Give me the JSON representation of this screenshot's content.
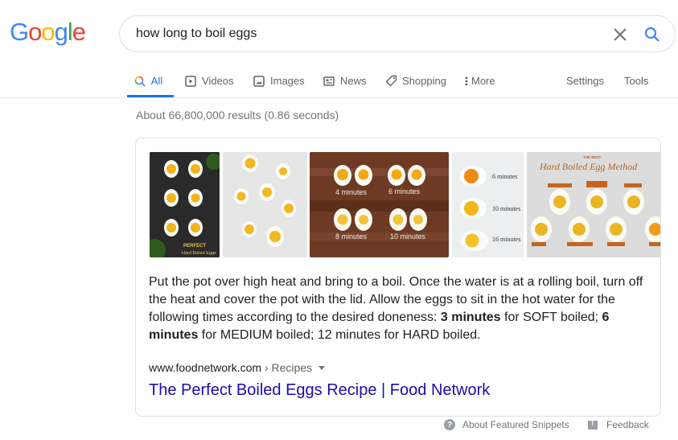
{
  "logo": {
    "letters": [
      {
        "char": "G",
        "color": "#4285f4"
      },
      {
        "char": "o",
        "color": "#ea4335"
      },
      {
        "char": "o",
        "color": "#fbbc05"
      },
      {
        "char": "g",
        "color": "#4285f4"
      },
      {
        "char": "l",
        "color": "#34a853"
      },
      {
        "char": "e",
        "color": "#ea4335"
      }
    ]
  },
  "search": {
    "query": "how long to boil eggs",
    "clear_icon": "close-icon",
    "search_icon": "search-icon"
  },
  "tabs": [
    {
      "label": "All",
      "icon": "search-icon",
      "active": true
    },
    {
      "label": "Videos",
      "icon": "play-icon",
      "active": false
    },
    {
      "label": "Images",
      "icon": "image-icon",
      "active": false
    },
    {
      "label": "News",
      "icon": "newspaper-icon",
      "active": false
    },
    {
      "label": "Shopping",
      "icon": "tag-icon",
      "active": false
    },
    {
      "label": "More",
      "icon": "more-vert-icon",
      "active": false
    },
    {
      "label": "Settings",
      "active": false
    },
    {
      "label": "Tools",
      "active": false
    }
  ],
  "result_stats": "About 66,800,000 results (0.86 seconds)",
  "featured_snippet": {
    "images": [
      {
        "alt": "Perfect Hard Boiled Eggs chart",
        "labels": [
          "PERFECT",
          "Hard Boiled Eggs"
        ]
      },
      {
        "alt": "Boiled eggs doneness levels",
        "labels": []
      },
      {
        "alt": "Eggs on wooden board",
        "labels": [
          "4 minutes",
          "6 minutes",
          "8 minutes",
          "10 minutes"
        ]
      },
      {
        "alt": "Eggs by minutes",
        "labels": [
          "6 minutes",
          "10 minutes",
          "16 minutes"
        ]
      },
      {
        "alt": "The Best Hard Boiled Egg Method",
        "labels": [
          "THE BEST",
          "Hard Boiled Egg Method"
        ]
      }
    ],
    "text_parts": [
      {
        "text": "Put the pot over high heat and bring to a boil. Once the water is at a rolling boil, turn off the heat and cover the pot with the lid. Allow the eggs to sit in the hot water for the following times according to the desired doneness: ",
        "bold": false
      },
      {
        "text": "3 minutes",
        "bold": true
      },
      {
        "text": " for SOFT boiled; ",
        "bold": false
      },
      {
        "text": "6 minutes",
        "bold": true
      },
      {
        "text": " for MEDIUM boiled; 12 minutes for HARD boiled.",
        "bold": false
      }
    ],
    "cite_domain": "www.foodnetwork.com",
    "cite_separator": " › ",
    "cite_path": "Recipes",
    "title": "The Perfect Boiled Eggs Recipe | Food Network"
  },
  "footer": {
    "about_label": "About Featured Snippets",
    "feedback_label": "Feedback"
  },
  "colors": {
    "link": "#1a0dab",
    "accent": "#1a73e8",
    "muted": "#70757a"
  }
}
